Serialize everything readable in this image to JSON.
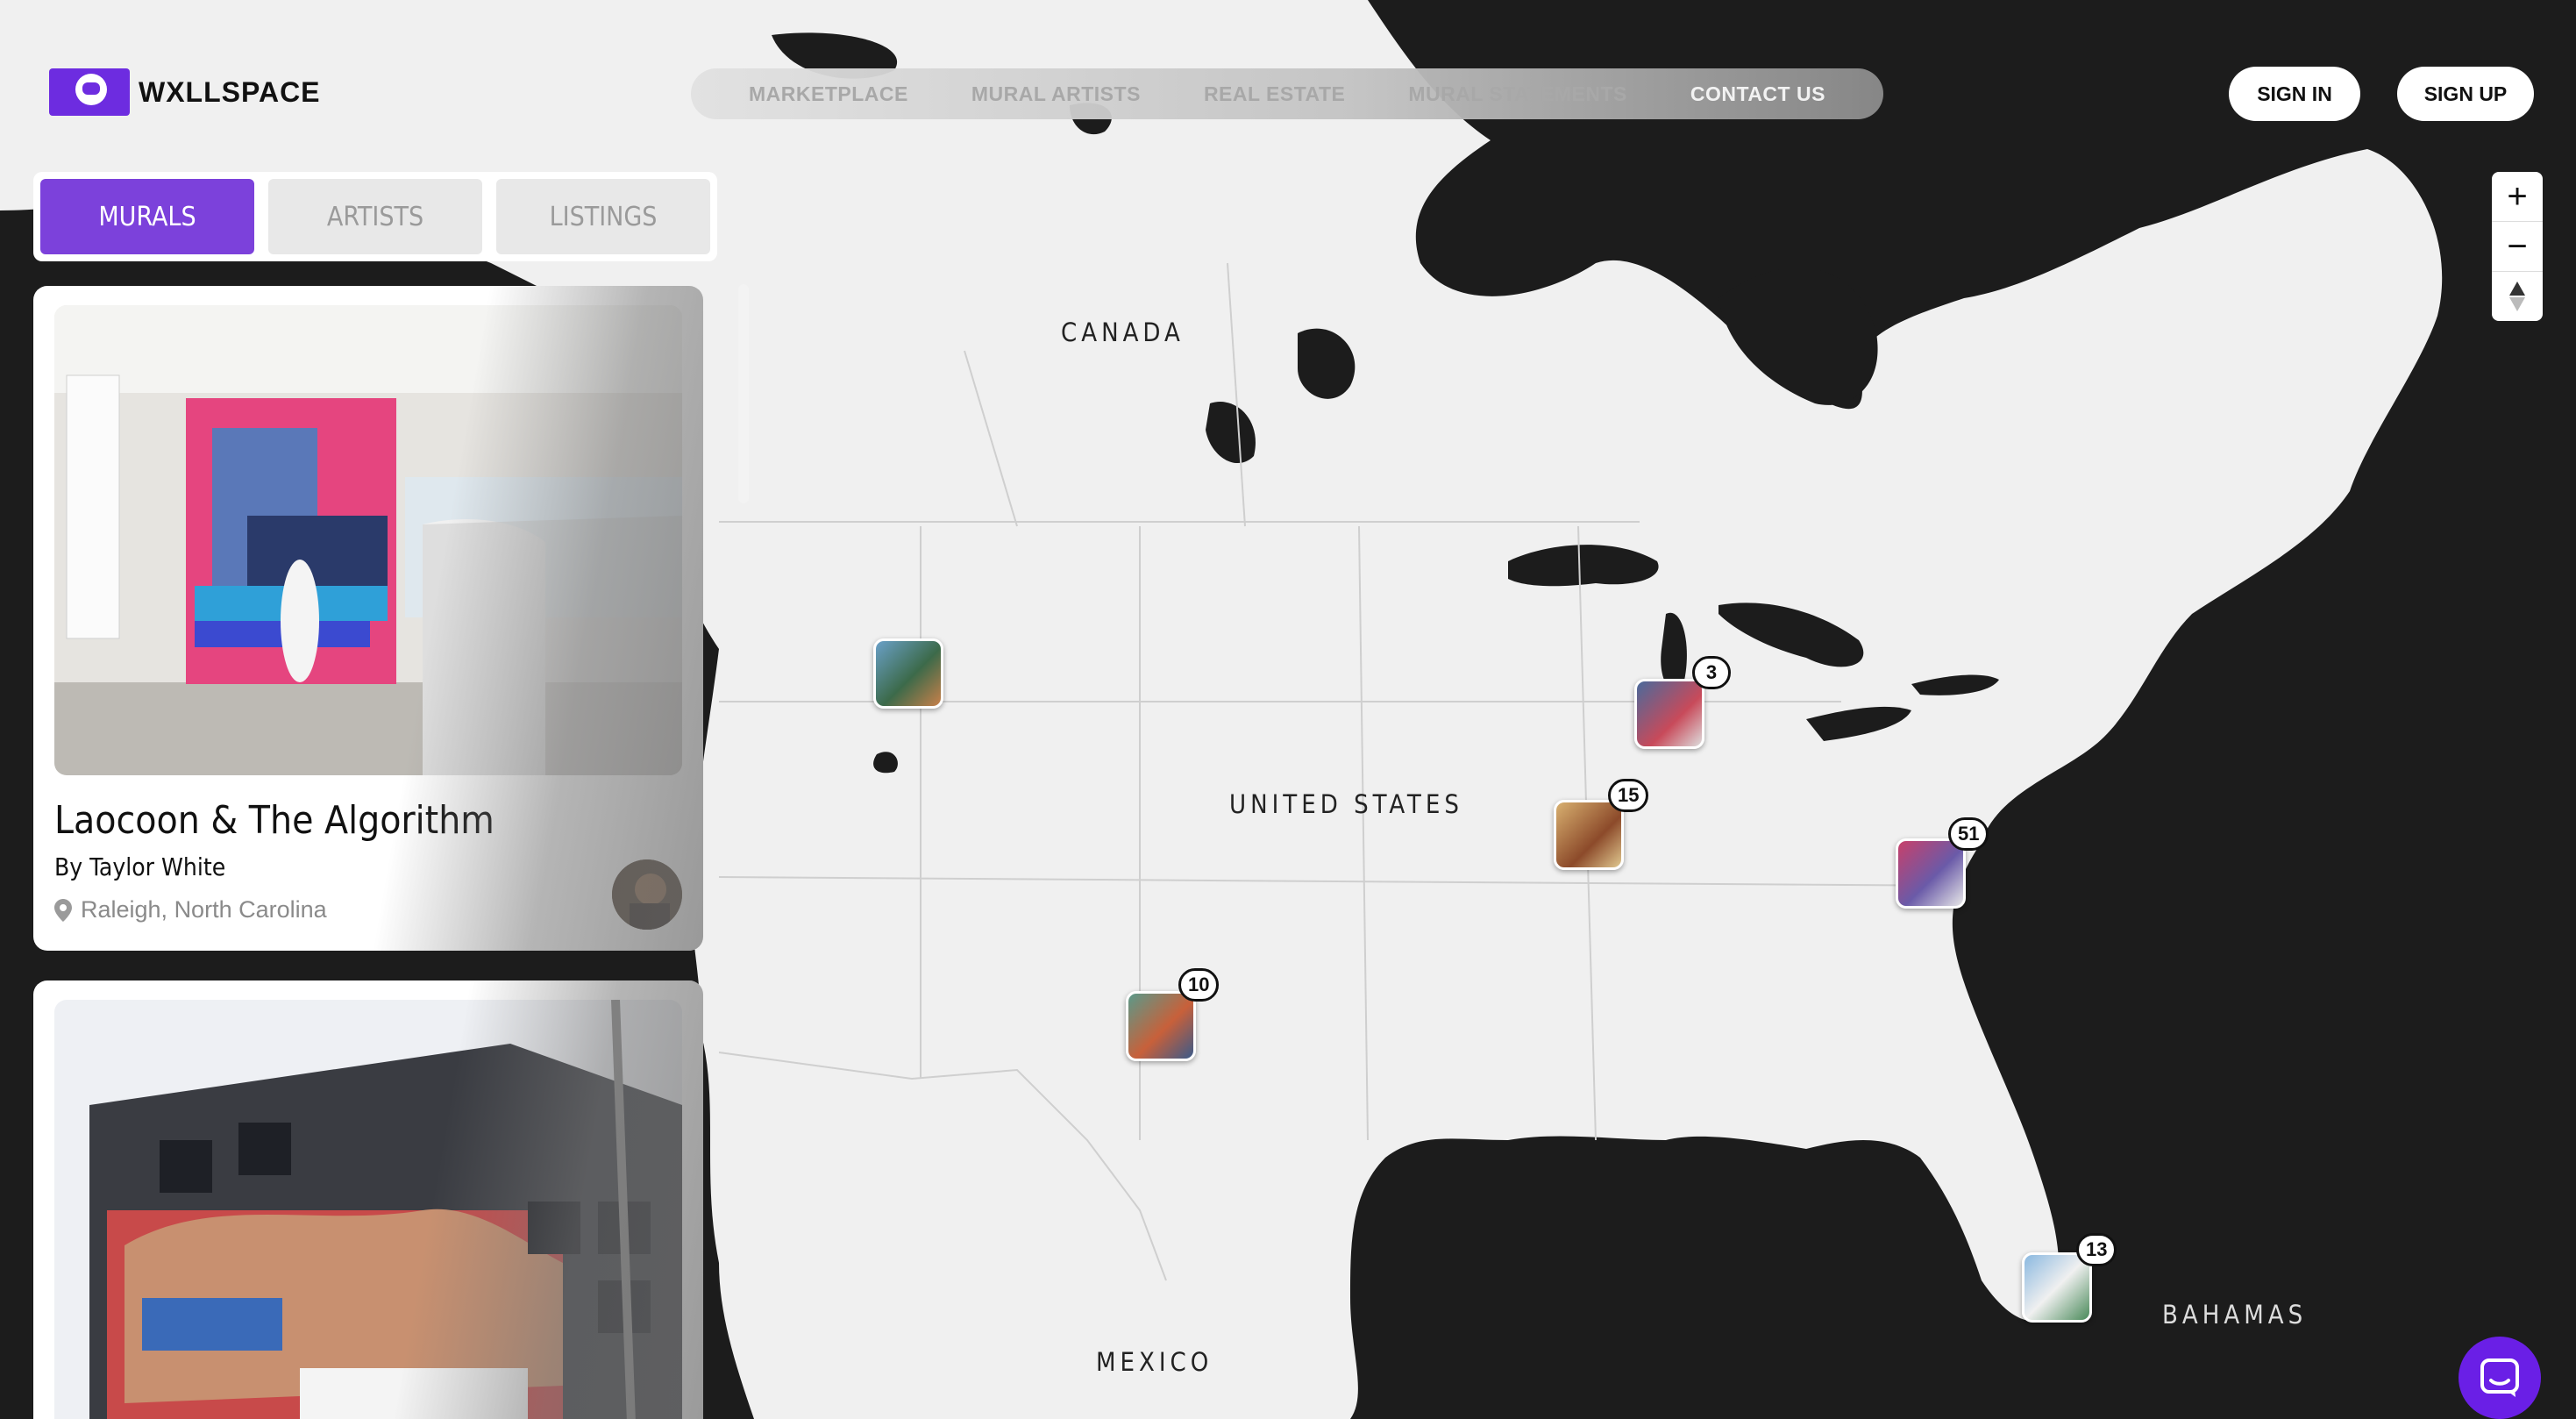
{
  "brand": {
    "name": "WXLLSPACE"
  },
  "nav": {
    "items": [
      "MARKETPLACE",
      "MURAL ARTISTS",
      "REAL ESTATE",
      "MURAL STATEMENTS",
      "CONTACT US"
    ]
  },
  "auth": {
    "sign_in": "SIGN IN",
    "sign_up": "SIGN UP"
  },
  "tabs": {
    "murals": "MURALS",
    "artists": "ARTISTS",
    "listings": "LISTINGS",
    "active": "MURALS"
  },
  "cards": [
    {
      "title": "Laocoon & The Algorithm",
      "artist": "By Taylor White",
      "location": "Raleigh, North Carolina"
    },
    {
      "title": "",
      "artist": "",
      "location": ""
    }
  ],
  "map": {
    "labels": {
      "canada": "CANADA",
      "usa": "UNITED STATES",
      "mexico": "MEXICO",
      "bahamas": "BAHAMAS"
    },
    "clusters": {
      "michigan": "3",
      "missouri": "15",
      "carolina": "51",
      "texas": "10",
      "florida": "13"
    }
  },
  "zoom": {
    "in": "+",
    "out": "−"
  },
  "colors": {
    "accent": "#7c41db",
    "land": "#f0f0f0",
    "water": "#1c1c1c",
    "chat": "#6a1fe6"
  },
  "icons": {
    "location": "map-pin-icon",
    "chat": "chat-icon",
    "compass": "compass-icon"
  }
}
